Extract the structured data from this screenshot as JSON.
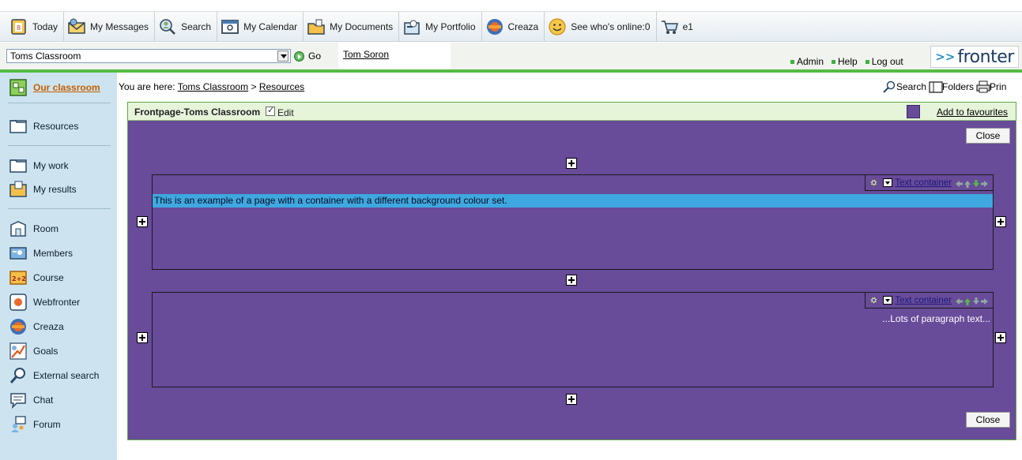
{
  "toolbar": {
    "items": [
      {
        "label": "Today",
        "icon": "calendar-day-icon"
      },
      {
        "label": "My Messages",
        "icon": "envelope-icon"
      },
      {
        "label": "Search",
        "icon": "search-people-icon"
      },
      {
        "label": "My Calendar",
        "icon": "calendar-icon"
      },
      {
        "label": "My Documents",
        "icon": "folder-icon"
      },
      {
        "label": "My Portfolio",
        "icon": "portfolio-icon"
      },
      {
        "label": "Creaza",
        "icon": "creaza-icon"
      },
      {
        "label": "See who's online:0",
        "icon": "smiley-icon"
      },
      {
        "label": "e1",
        "icon": "cart-icon"
      }
    ]
  },
  "classbar": {
    "selected_classroom": "Toms Classroom",
    "go_label": "Go",
    "user_name": "Tom Soron",
    "links": {
      "admin": "Admin",
      "help": "Help",
      "logout": "Log out"
    },
    "logo_arrows": ">>",
    "logo_text": "fronter"
  },
  "sidebar": {
    "active": "Our classroom",
    "items": [
      {
        "label": "Resources",
        "icon": "folder-icon"
      },
      {
        "label": "My work",
        "icon": "folder-icon"
      },
      {
        "label": "My results",
        "icon": "results-folder-icon"
      },
      {
        "label": "Room",
        "icon": "room-icon"
      },
      {
        "label": "Members",
        "icon": "members-icon"
      },
      {
        "label": "Course",
        "icon": "course-icon"
      },
      {
        "label": "Webfronter",
        "icon": "webfronter-icon"
      },
      {
        "label": "Creaza",
        "icon": "creaza-icon"
      },
      {
        "label": "Goals",
        "icon": "goals-icon"
      },
      {
        "label": "External search",
        "icon": "magnifier-icon"
      },
      {
        "label": "Chat",
        "icon": "chat-icon"
      },
      {
        "label": "Forum",
        "icon": "forum-icon"
      }
    ]
  },
  "breadcrumb": {
    "prefix": "You are here:",
    "path": [
      "Toms Classroom",
      "Resources"
    ],
    "separator": ">"
  },
  "page_actions": {
    "search": "Search",
    "folders": "Folders",
    "print": "Prin"
  },
  "page": {
    "title": "Frontpage-Toms Classroom",
    "edit_label": "Edit",
    "edit_checked": true,
    "background_color": "#684b99",
    "add_to_favourites": "Add to favourites",
    "close_label": "Close",
    "containers": [
      {
        "type_label": "Text container",
        "text": "This is an example of a page with a container with a different background colour set.",
        "highlight_color": "#3fa8e0"
      },
      {
        "type_label": "Text container",
        "text": "...Lots of paragraph text..."
      }
    ]
  },
  "colors": {
    "accent_green": "#55bb44",
    "sidebar_bg": "#cde4f0",
    "active_orange": "#c55f00"
  }
}
